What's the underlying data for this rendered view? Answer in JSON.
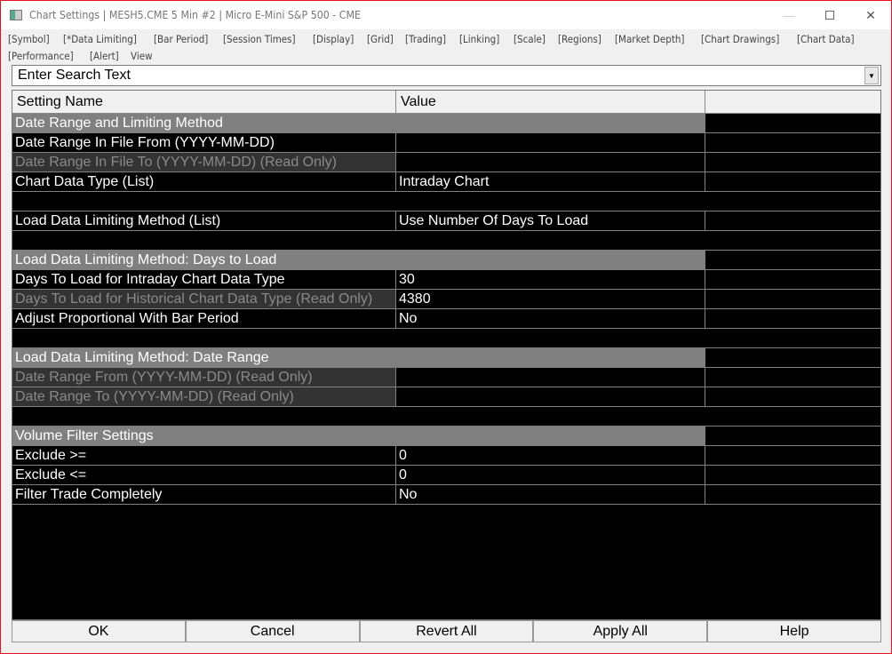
{
  "window": {
    "title": "Chart Settings | MESH5.CME  5 Min  #2 | Micro E-Mini S&P 500 - CME"
  },
  "tabs": [
    "[Symbol]",
    "[*Data Limiting]",
    "[Bar Period]",
    "[Session Times]",
    "[Display]",
    "[Grid]",
    "[Trading]",
    "[Linking]",
    "[Scale]",
    "[Regions]",
    "[Market Depth]",
    "[Chart Drawings]",
    "[Chart Data]",
    "[Performance]",
    "[Alert]",
    "View"
  ],
  "search": {
    "placeholder": "Enter Search Text"
  },
  "grid": {
    "headers": [
      "Setting Name",
      "Value",
      ""
    ],
    "rows": [
      {
        "type": "section",
        "name": "Date Range and Limiting Method"
      },
      {
        "type": "normal",
        "name": "Date Range In File From (YYYY-MM-DD)",
        "value": ""
      },
      {
        "type": "readonly",
        "name": "Date Range In File To (YYYY-MM-DD) (Read Only)",
        "value": ""
      },
      {
        "type": "normal",
        "name": "Chart Data Type (List)",
        "value": "Intraday Chart"
      },
      {
        "type": "blank"
      },
      {
        "type": "normal",
        "name": "Load Data Limiting Method (List)",
        "value": "Use Number Of Days To Load"
      },
      {
        "type": "blank"
      },
      {
        "type": "section",
        "name": "Load Data Limiting Method: Days to Load"
      },
      {
        "type": "normal",
        "name": "Days To Load for Intraday Chart Data Type",
        "value": "30"
      },
      {
        "type": "readonly",
        "name": "Days To Load for Historical Chart Data Type (Read Only)",
        "value": "4380"
      },
      {
        "type": "normal",
        "name": "Adjust Proportional With Bar Period",
        "value": "No"
      },
      {
        "type": "blank"
      },
      {
        "type": "section",
        "name": "Load Data Limiting Method: Date Range"
      },
      {
        "type": "readonly",
        "name": "Date Range From (YYYY-MM-DD) (Read Only)",
        "value": ""
      },
      {
        "type": "readonly",
        "name": "Date Range To (YYYY-MM-DD) (Read Only)",
        "value": ""
      },
      {
        "type": "blank"
      },
      {
        "type": "section",
        "name": "Volume Filter Settings"
      },
      {
        "type": "normal",
        "name": "Exclude >=",
        "value": "0"
      },
      {
        "type": "normal",
        "name": "Exclude <=",
        "value": "0"
      },
      {
        "type": "normal",
        "name": "Filter Trade Completely",
        "value": "No"
      }
    ]
  },
  "buttons": [
    "OK",
    "Cancel",
    "Revert All",
    "Apply All",
    "Help"
  ]
}
